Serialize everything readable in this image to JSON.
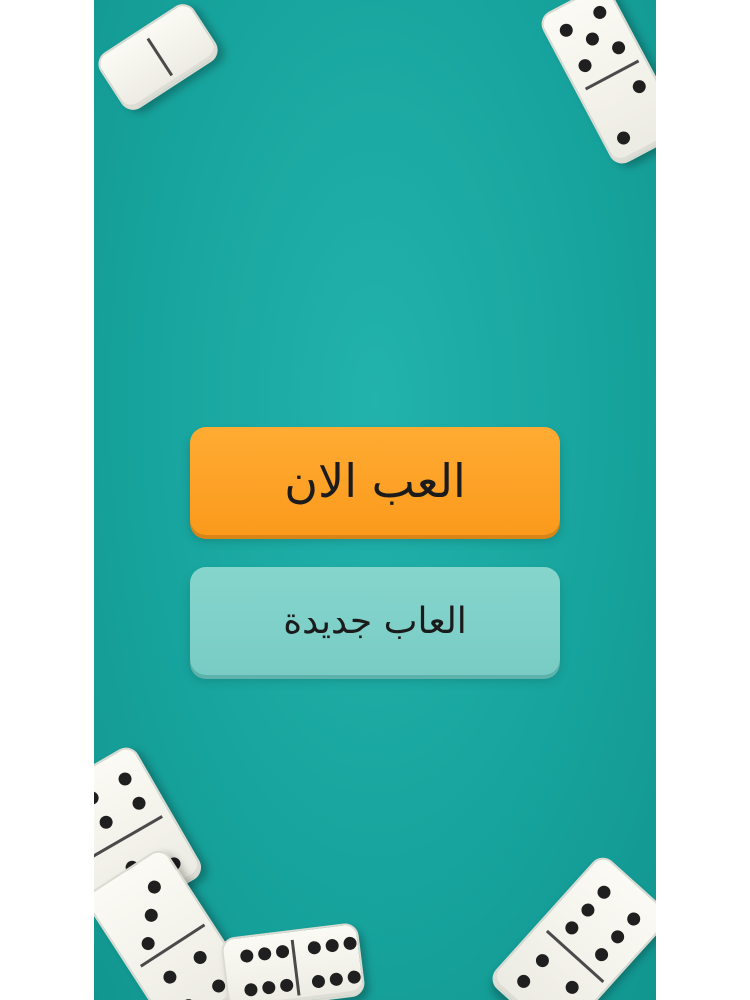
{
  "menu": {
    "play_now_label": "العب الان",
    "new_games_label": "العاب جديدة"
  },
  "colors": {
    "background": "#17a39d",
    "play_button": "#fb9a1c",
    "new_games_button": "#7dd0c8",
    "domino": "#f3f2ec",
    "pip": "#1f1f1f"
  }
}
